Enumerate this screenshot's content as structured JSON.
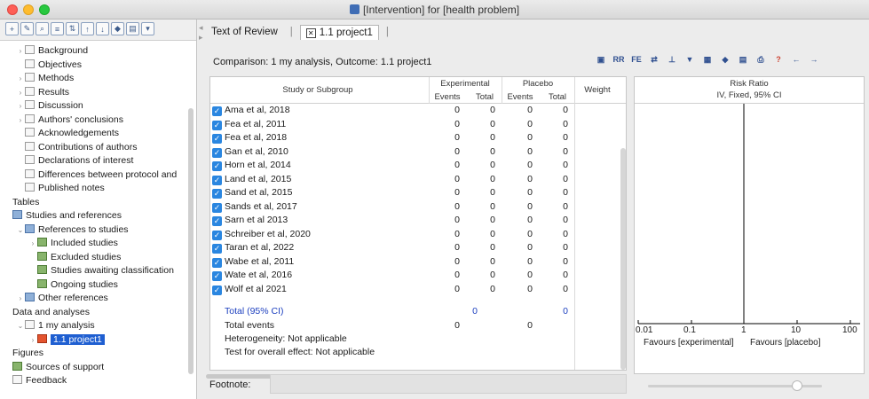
{
  "window": {
    "title": "[Intervention] for [health problem]"
  },
  "tree": [
    {
      "label": "Background",
      "icon": "doc",
      "indent": 1,
      "arrow": "›"
    },
    {
      "label": "Objectives",
      "icon": "doc",
      "indent": 1,
      "arrow": ""
    },
    {
      "label": "Methods",
      "icon": "doc",
      "indent": 1,
      "arrow": "›"
    },
    {
      "label": "Results",
      "icon": "doc",
      "indent": 1,
      "arrow": "›"
    },
    {
      "label": "Discussion",
      "icon": "doc",
      "indent": 1,
      "arrow": "›"
    },
    {
      "label": "Authors' conclusions",
      "icon": "doc",
      "indent": 1,
      "arrow": "›"
    },
    {
      "label": "Acknowledgements",
      "icon": "doc",
      "indent": 1,
      "arrow": ""
    },
    {
      "label": "Contributions of authors",
      "icon": "doc",
      "indent": 1,
      "arrow": ""
    },
    {
      "label": "Declarations of interest",
      "icon": "doc",
      "indent": 1,
      "arrow": ""
    },
    {
      "label": "Differences between protocol and",
      "icon": "doc",
      "indent": 1,
      "arrow": ""
    },
    {
      "label": "Published notes",
      "icon": "doc",
      "indent": 1,
      "arrow": ""
    },
    {
      "label": "Tables",
      "icon": "grid",
      "indent": 0,
      "arrow": ""
    },
    {
      "label": "Studies and references",
      "icon": "folder",
      "indent": 0,
      "arrow": ""
    },
    {
      "label": "References to studies",
      "icon": "folder",
      "indent": 1,
      "arrow": "⌄"
    },
    {
      "label": "Included studies",
      "icon": "study",
      "indent": 2,
      "arrow": "›"
    },
    {
      "label": "Excluded studies",
      "icon": "study",
      "indent": 2,
      "arrow": ""
    },
    {
      "label": "Studies awaiting classification",
      "icon": "study",
      "indent": 2,
      "arrow": ""
    },
    {
      "label": "Ongoing studies",
      "icon": "study",
      "indent": 2,
      "arrow": ""
    },
    {
      "label": "Other references",
      "icon": "folder",
      "indent": 1,
      "arrow": "›"
    },
    {
      "label": "Data and analyses",
      "icon": "grid",
      "indent": 0,
      "arrow": ""
    },
    {
      "label": "1 my analysis",
      "icon": "doc",
      "indent": 1,
      "arrow": "⌄"
    },
    {
      "label": "1.1 project1",
      "icon": "red",
      "indent": 2,
      "arrow": "›",
      "selected": true
    },
    {
      "label": "Figures",
      "icon": "grid",
      "indent": 0,
      "arrow": ""
    },
    {
      "label": "Sources of support",
      "icon": "study",
      "indent": 0,
      "arrow": ""
    },
    {
      "label": "Feedback",
      "icon": "doc",
      "indent": 0,
      "arrow": ""
    }
  ],
  "tabs": {
    "review": "Text of Review",
    "project": "1.1 project1"
  },
  "comparison": "Comparison: 1 my analysis, Outcome: 1.1 project1",
  "toolbar_right": [
    "RR",
    "FE"
  ],
  "grid": {
    "h_study": "Study or Subgroup",
    "h_exp": "Experimental",
    "h_plac": "Placebo",
    "h_events": "Events",
    "h_total": "Total",
    "h_weight": "Weight",
    "h_rr": "Risk Ratio",
    "h_method": "IV, Fixed, 95% CI"
  },
  "studies": [
    {
      "name": "Ama et al, 2018",
      "e_ev": "0",
      "e_tot": "0",
      "p_ev": "0",
      "p_tot": "0"
    },
    {
      "name": "Fea et al, 2011",
      "e_ev": "0",
      "e_tot": "0",
      "p_ev": "0",
      "p_tot": "0"
    },
    {
      "name": "Fea et al, 2018",
      "e_ev": "0",
      "e_tot": "0",
      "p_ev": "0",
      "p_tot": "0"
    },
    {
      "name": "Gan et al, 2010",
      "e_ev": "0",
      "e_tot": "0",
      "p_ev": "0",
      "p_tot": "0"
    },
    {
      "name": "Horn et al, 2014",
      "e_ev": "0",
      "e_tot": "0",
      "p_ev": "0",
      "p_tot": "0"
    },
    {
      "name": "Land et al, 2015",
      "e_ev": "0",
      "e_tot": "0",
      "p_ev": "0",
      "p_tot": "0"
    },
    {
      "name": "Sand et al, 2015",
      "e_ev": "0",
      "e_tot": "0",
      "p_ev": "0",
      "p_tot": "0"
    },
    {
      "name": "Sands et al, 2017",
      "e_ev": "0",
      "e_tot": "0",
      "p_ev": "0",
      "p_tot": "0"
    },
    {
      "name": "Sarn et al 2013",
      "e_ev": "0",
      "e_tot": "0",
      "p_ev": "0",
      "p_tot": "0"
    },
    {
      "name": "Schreiber et al, 2020",
      "e_ev": "0",
      "e_tot": "0",
      "p_ev": "0",
      "p_tot": "0"
    },
    {
      "name": "Taran et al, 2022",
      "e_ev": "0",
      "e_tot": "0",
      "p_ev": "0",
      "p_tot": "0"
    },
    {
      "name": "Wabe et al, 2011",
      "e_ev": "0",
      "e_tot": "0",
      "p_ev": "0",
      "p_tot": "0"
    },
    {
      "name": "Wate et al, 2016",
      "e_ev": "0",
      "e_tot": "0",
      "p_ev": "0",
      "p_tot": "0"
    },
    {
      "name": "Wolf et al 2021",
      "e_ev": "0",
      "e_tot": "0",
      "p_ev": "0",
      "p_tot": "0"
    }
  ],
  "summary": {
    "total_label": "Total (95% CI)",
    "total_exp": "0",
    "total_plac": "0",
    "events_label": "Total events",
    "events_exp": "0",
    "events_plac": "0",
    "heterogeneity": "Heterogeneity: Not applicable",
    "overall": "Test for overall effect: Not applicable"
  },
  "axis": {
    "ticks": [
      "0.01",
      "0.1",
      "1",
      "10",
      "100"
    ],
    "favours_left": "Favours [experimental]",
    "favours_right": "Favours [placebo]"
  },
  "footnote_label": "Footnote:",
  "colors": {
    "selection": "#1f5fd1",
    "total_text": "#1c3fbf",
    "checkbox": "#2a86e0"
  }
}
